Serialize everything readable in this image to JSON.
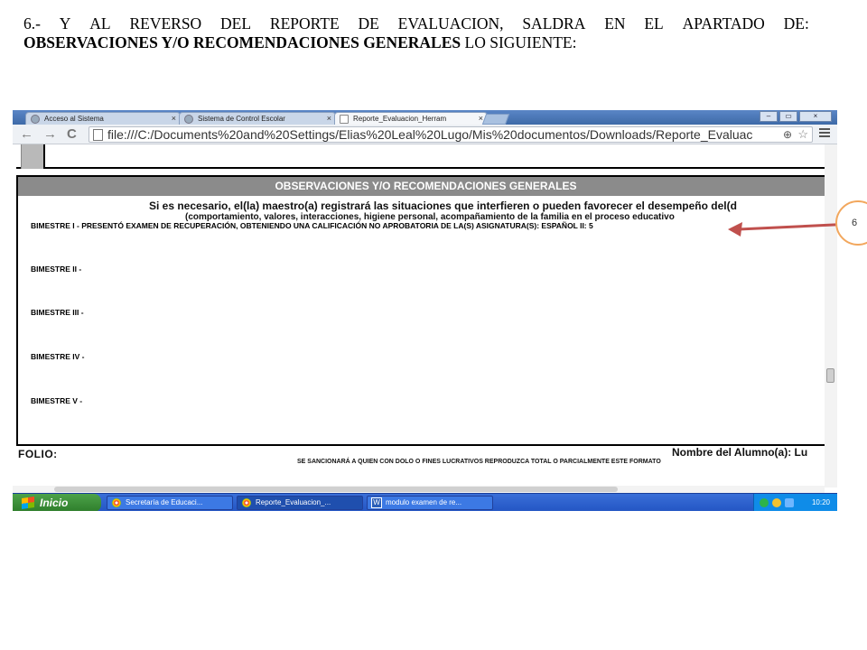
{
  "caption": {
    "line1_words": [
      "6.-",
      "Y",
      "AL",
      "REVERSO",
      "DEL",
      "REPORTE",
      "DE",
      "EVALUACION,",
      "SALDRA",
      "EN",
      "EL",
      "APARTADO",
      "DE:"
    ],
    "line2_bold": "OBSERVACIONES Y/O RECOMENDACIONES GENERALES",
    "line2_rest": " LO SIGUIENTE:"
  },
  "browser": {
    "tabs": [
      {
        "label": "Acceso al Sistema",
        "close": "×"
      },
      {
        "label": "Sistema de Control Escolar",
        "close": "×"
      },
      {
        "label": "Reporte_Evaluacion_Herram",
        "close": "×",
        "active": true
      }
    ],
    "window_buttons": {
      "minimize": "–",
      "maximize": "▭",
      "close": "×"
    },
    "nav": {
      "back": "←",
      "forward": "→",
      "reload": "C"
    },
    "url": "file:///C:/Documents%20and%20Settings/Elias%20Leal%20Lugo/Mis%20documentos/Downloads/Reporte_Evaluac",
    "zoom_icon": "⊕",
    "star_icon": "☆"
  },
  "report": {
    "panel_title": "OBSERVACIONES Y/O RECOMENDACIONES GENERALES",
    "intro1": "Si es necesario, el(la) maestro(a) registrará las situaciones que interfieren o pueden favorecer el desempeño del(d",
    "intro2": "(comportamiento, valores, interacciones, higiene personal, acompañamiento de la familia en el proceso educativo",
    "bimestres": [
      "BIMESTRE I - PRESENTÓ EXAMEN DE RECUPERACIÓN, OBTENIENDO UNA CALIFICACIÓN NO APROBATORIA DE LA(S) ASIGNATURA(S):  ESPAÑOL II: 5",
      "BIMESTRE II -",
      "BIMESTRE III -",
      "BIMESTRE IV -",
      "BIMESTRE V -"
    ],
    "folio": "FOLIO:",
    "student_name_label": "Nombre del Alumno(a): Lu",
    "warning": "SE SANCIONARÁ A QUIEN CON DOLO O FINES LUCRATIVOS REPRODUZCA TOTAL O PARCIALMENTE ESTE FORMATO"
  },
  "taskbar": {
    "start": "Inicio",
    "tasks": [
      {
        "label": "Secretaría de Educaci..."
      },
      {
        "label": "Reporte_Evaluacion_..."
      },
      {
        "label": "modulo examen de re..."
      }
    ],
    "word_glyph": "W",
    "clock": "10:20"
  },
  "callout": {
    "number": "6"
  },
  "colors": {
    "callout_border": "#f2a75d",
    "arrow": "#c0504d",
    "panel_header": "#8b8b8b"
  }
}
